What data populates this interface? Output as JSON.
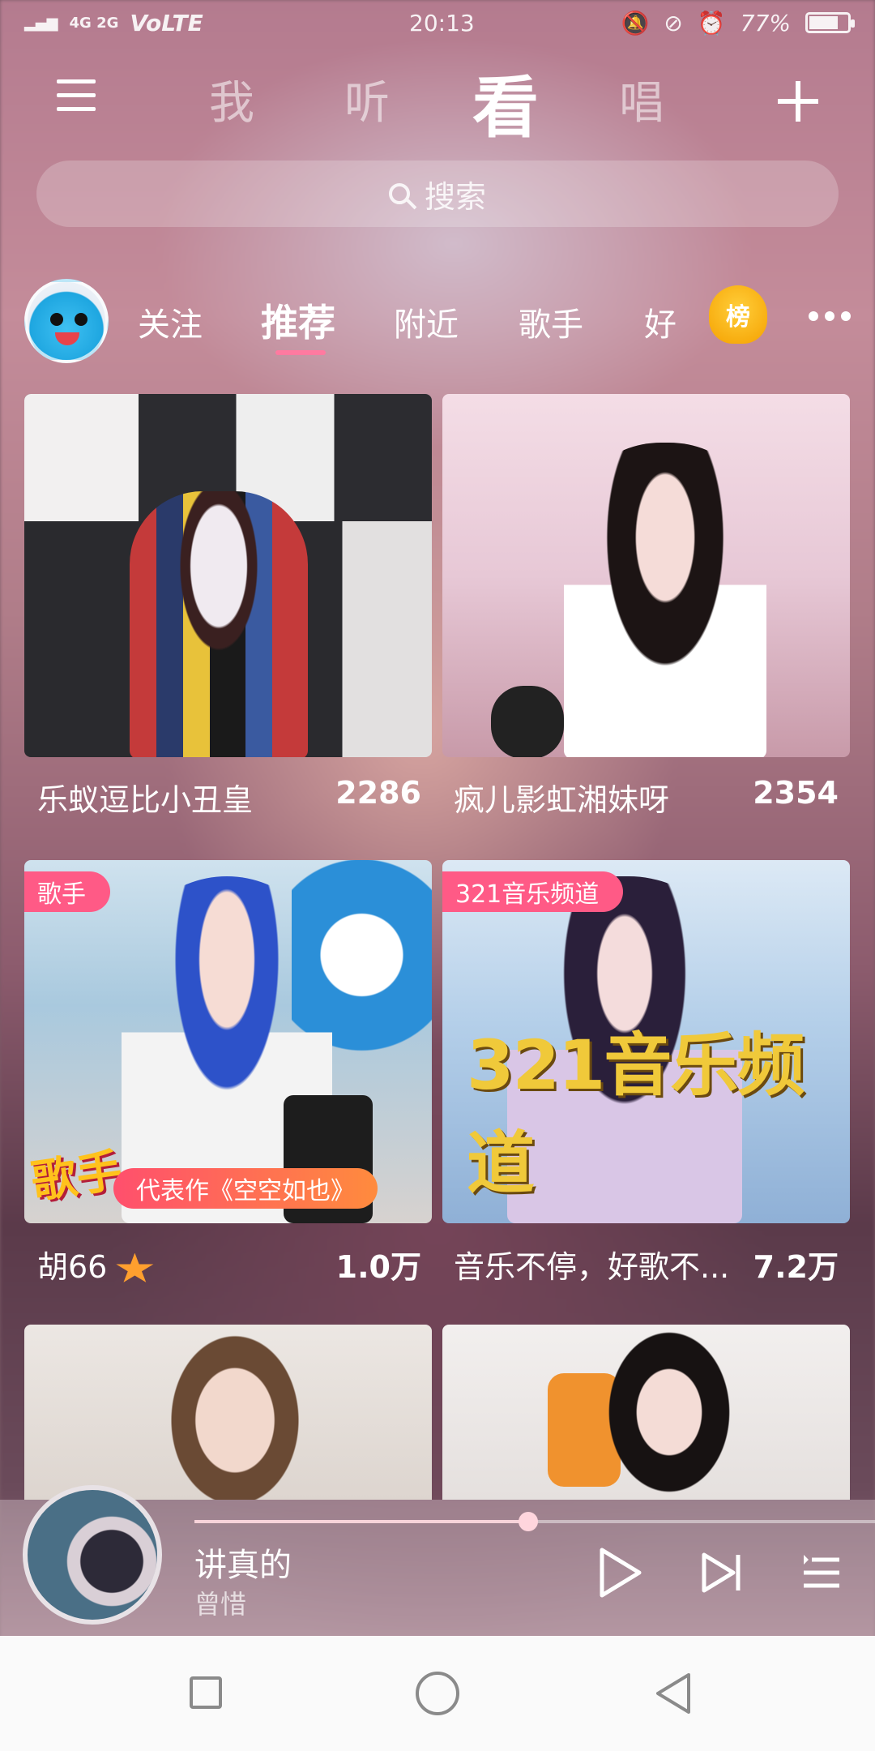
{
  "status_bar": {
    "network": "4G  2G",
    "volte": "VoLTE",
    "time": "20:13",
    "battery": "77%",
    "battery_level": 0.77
  },
  "top_tabs": [
    {
      "label": "我",
      "active": false
    },
    {
      "label": "听",
      "active": false
    },
    {
      "label": "看",
      "active": true
    },
    {
      "label": "唱",
      "active": false
    }
  ],
  "search": {
    "placeholder": "搜索"
  },
  "categories": [
    {
      "label": "关注",
      "active": false
    },
    {
      "label": "推荐",
      "active": true
    },
    {
      "label": "附近",
      "active": false
    },
    {
      "label": "歌手",
      "active": false
    },
    {
      "label": "好",
      "active": false
    }
  ],
  "rank_badge": "榜",
  "cards": [
    {
      "title": "乐蚁逗比小丑皇",
      "count": "2286",
      "tag": "",
      "banner": ""
    },
    {
      "title": "疯儿影虹湘妹呀",
      "count": "2354",
      "tag": "",
      "banner": ""
    },
    {
      "title": "胡66",
      "count": "1.0万",
      "tag": "歌手",
      "banner": "代表作《空空如也》",
      "logo": "歌手"
    },
    {
      "title": "音乐不停，好歌不...",
      "count": "7.2万",
      "tag": "321音乐频道",
      "banner": "",
      "logo": "321音乐频道"
    },
    {
      "title": "",
      "count": "",
      "tag": "",
      "banner": ""
    },
    {
      "title": "",
      "count": "",
      "tag": "",
      "banner": ""
    }
  ],
  "player": {
    "song": "讲真的",
    "artist": "曾惜",
    "progress": 0.49
  },
  "colors": {
    "accent": "#ff7aa0",
    "tag_pink": "#ff5a86",
    "rank_gold": "#f5a100"
  }
}
